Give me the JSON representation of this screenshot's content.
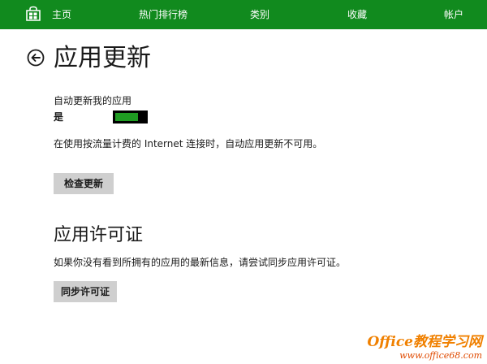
{
  "nav": {
    "home": "主页",
    "top_charts": "热门排行榜",
    "categories": "类别",
    "favorites": "收藏",
    "account": "帐户"
  },
  "page": {
    "title": "应用更新"
  },
  "auto_update": {
    "label": "自动更新我的应用",
    "state_label": "是",
    "enabled": true,
    "note": "在使用按流量计费的 Internet 连接时，自动应用更新不可用。",
    "check_button": "检查更新"
  },
  "licenses": {
    "title": "应用许可证",
    "description": "如果你没有看到所拥有的应用的最新信息，请尝试同步应用许可证。",
    "sync_button": "同步许可证"
  },
  "watermark": {
    "line1": "Office教程学习网",
    "line2": "www.office68.com"
  },
  "colors": {
    "nav_background": "#118a1e",
    "toggle_on": "#1f9b22",
    "button_background": "#cfcfcf"
  },
  "icons": {
    "store": "store-icon",
    "back": "back-arrow-icon"
  }
}
